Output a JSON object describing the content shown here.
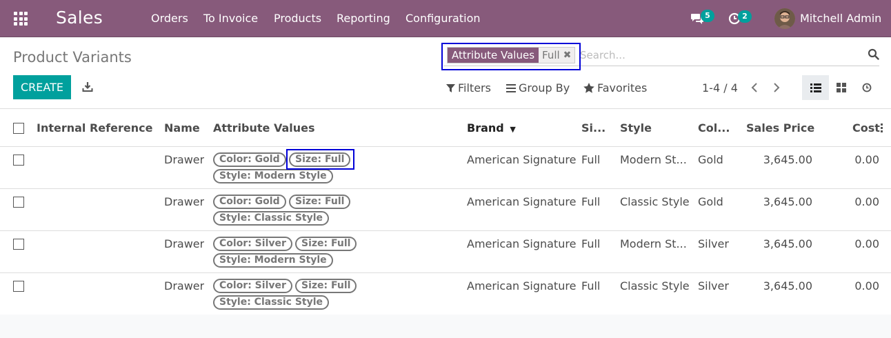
{
  "navbar": {
    "app_name": "Sales",
    "menus": [
      "Orders",
      "To Invoice",
      "Products",
      "Reporting",
      "Configuration"
    ],
    "messages_count": "5",
    "activities_count": "2",
    "user_name": "Mitchell Admin",
    "bg_color": "#875a7b"
  },
  "control_panel": {
    "title": "Product Variants",
    "search": {
      "facet_category": "Attribute Values",
      "facet_value": "Full",
      "placeholder": "Search..."
    },
    "create_label": "CREATE",
    "filters_label": "Filters",
    "groupby_label": "Group By",
    "favorites_label": "Favorites",
    "pager": "1-4 / 4",
    "accent_color": "#00a09d"
  },
  "table": {
    "headers": {
      "internal_reference": "Internal Reference",
      "name": "Name",
      "attribute_values": "Attribute Values",
      "brand": "Brand",
      "size": "Si...",
      "style": "Style",
      "color": "Col...",
      "sales_price": "Sales Price",
      "cost": "Cost"
    },
    "rows": [
      {
        "name": "Drawer",
        "chips": [
          "Color: Gold",
          "Size: Full",
          "Style: Modern Style"
        ],
        "brand": "American Signature",
        "size": "Full",
        "style": "Modern St...",
        "color": "Gold",
        "price": "3,645.00",
        "cost": "0.00"
      },
      {
        "name": "Drawer",
        "chips": [
          "Color: Gold",
          "Size: Full",
          "Style: Classic Style"
        ],
        "brand": "American Signature",
        "size": "Full",
        "style": "Classic Style",
        "color": "Gold",
        "price": "3,645.00",
        "cost": "0.00"
      },
      {
        "name": "Drawer",
        "chips": [
          "Color: Silver",
          "Size: Full",
          "Style: Modern Style"
        ],
        "brand": "American Signature",
        "size": "Full",
        "style": "Modern St...",
        "color": "Silver",
        "price": "3,645.00",
        "cost": "0.00"
      },
      {
        "name": "Drawer",
        "chips": [
          "Color: Silver",
          "Size: Full",
          "Style: Classic Style"
        ],
        "brand": "American Signature",
        "size": "Full",
        "style": "Classic Style",
        "color": "Silver",
        "price": "3,645.00",
        "cost": "0.00"
      }
    ]
  }
}
